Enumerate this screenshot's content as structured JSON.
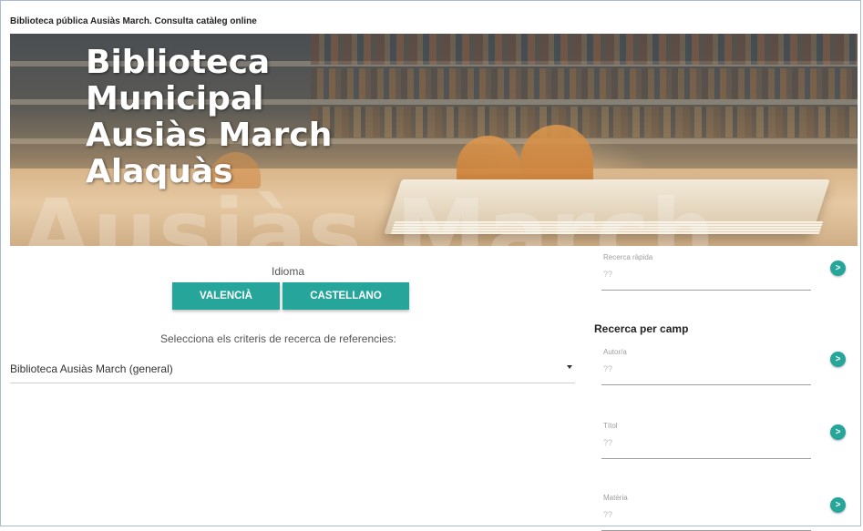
{
  "window": {
    "title": "Biblioteca pública Ausiàs March. Consulta catàleg online"
  },
  "banner": {
    "title_lines": [
      "Biblioteca",
      "Municipal",
      "Ausiàs March",
      "Alaquàs"
    ],
    "watermark": "Ausiàs March"
  },
  "language": {
    "label": "Idioma",
    "valencia": "VALENCIÀ",
    "castellano": "CASTELLANO"
  },
  "criteria": {
    "prompt": "Selecciona els criteris de recerca de referencies:",
    "selected": "Biblioteca Ausiàs March (general)"
  },
  "quick_search": {
    "label": "Recerca ràpida",
    "placeholder": "??",
    "go_label": ">"
  },
  "field_search": {
    "heading": "Recerca per camp",
    "fields": [
      {
        "label": "Autor/a",
        "placeholder": "??",
        "go_label": ">"
      },
      {
        "label": "Títol",
        "placeholder": "??",
        "go_label": ">"
      },
      {
        "label": "Matèria",
        "placeholder": "??",
        "go_label": ">"
      }
    ]
  },
  "colors": {
    "accent": "#26a69a",
    "frame": "#a8bcd6"
  },
  "icons": {
    "select_caret": "caret-down-icon",
    "go": "arrow-right-icon"
  }
}
